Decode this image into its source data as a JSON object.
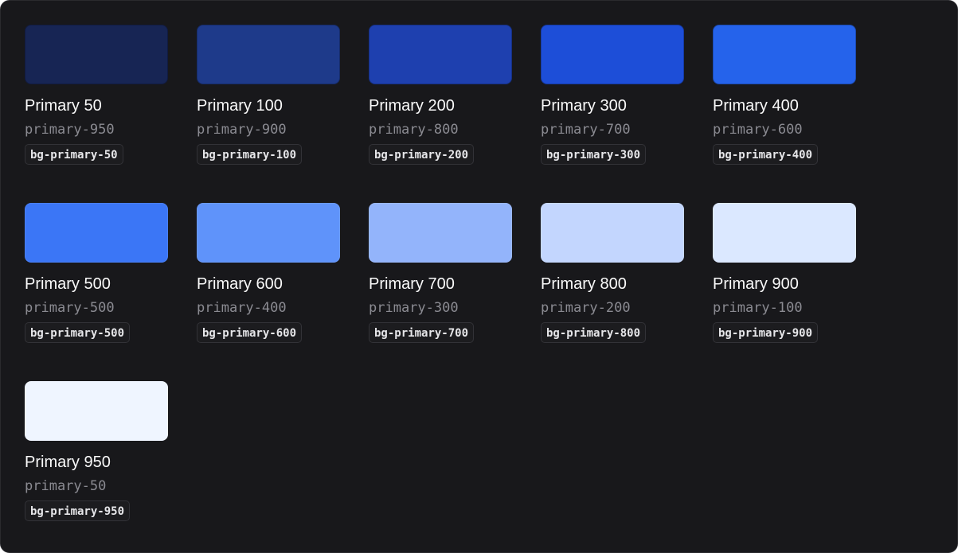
{
  "swatches": [
    {
      "name": "Primary 50",
      "token": "primary-950",
      "class_name": "bg-primary-50",
      "color": "#172554"
    },
    {
      "name": "Primary 100",
      "token": "primary-900",
      "class_name": "bg-primary-100",
      "color": "#1e3a8a"
    },
    {
      "name": "Primary 200",
      "token": "primary-800",
      "class_name": "bg-primary-200",
      "color": "#1e40af"
    },
    {
      "name": "Primary 300",
      "token": "primary-700",
      "class_name": "bg-primary-300",
      "color": "#1d4ed8"
    },
    {
      "name": "Primary 400",
      "token": "primary-600",
      "class_name": "bg-primary-400",
      "color": "#2563eb"
    },
    {
      "name": "Primary 500",
      "token": "primary-500",
      "class_name": "bg-primary-500",
      "color": "#3b76f6"
    },
    {
      "name": "Primary 600",
      "token": "primary-400",
      "class_name": "bg-primary-600",
      "color": "#5f93fa"
    },
    {
      "name": "Primary 700",
      "token": "primary-300",
      "class_name": "bg-primary-700",
      "color": "#93b4fb"
    },
    {
      "name": "Primary 800",
      "token": "primary-200",
      "class_name": "bg-primary-800",
      "color": "#c3d6fe"
    },
    {
      "name": "Primary 900",
      "token": "primary-100",
      "class_name": "bg-primary-900",
      "color": "#dbe8ff"
    },
    {
      "name": "Primary 950",
      "token": "primary-50",
      "class_name": "bg-primary-950",
      "color": "#eff5ff"
    }
  ]
}
